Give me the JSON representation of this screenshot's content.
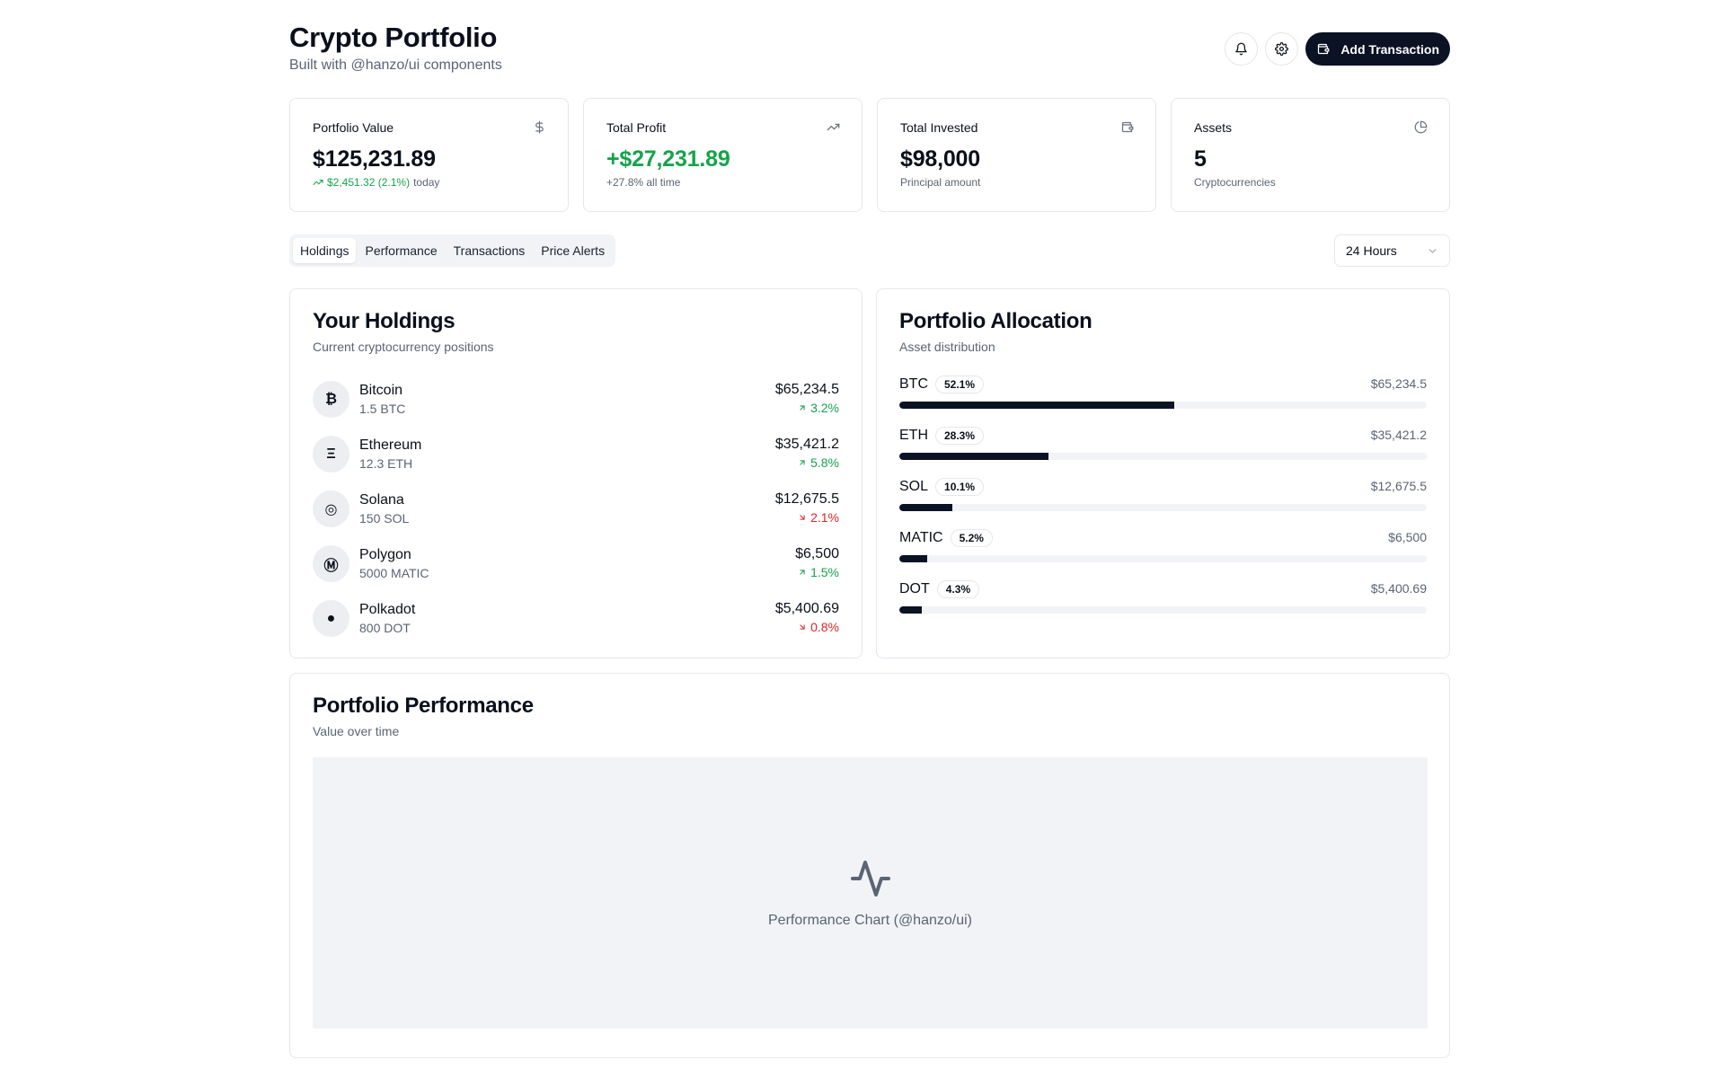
{
  "header": {
    "title": "Crypto Portfolio",
    "subtitle": "Built with @hanzo/ui components",
    "add_label": "Add Transaction"
  },
  "stats": [
    {
      "label": "Portfolio Value",
      "value": "$125,231.89",
      "sub_highlight": "$2,451.32 (2.1%)",
      "sub": "today",
      "icon": "dollar-icon"
    },
    {
      "label": "Total Profit",
      "value": "+$27,231.89",
      "sub": "+27.8% all time",
      "icon": "trending-up-icon"
    },
    {
      "label": "Total Invested",
      "value": "$98,000",
      "sub": "Principal amount",
      "icon": "wallet-icon"
    },
    {
      "label": "Assets",
      "value": "5",
      "sub": "Cryptocurrencies",
      "icon": "pie-chart-icon"
    }
  ],
  "tabs": [
    "Holdings",
    "Performance",
    "Transactions",
    "Price Alerts"
  ],
  "active_tab": "Holdings",
  "timeframe": "24 Hours",
  "holdings": {
    "title": "Your Holdings",
    "description": "Current cryptocurrency positions",
    "items": [
      {
        "symbol_glyph": "₿",
        "name": "Bitcoin",
        "amount": "1.5 BTC",
        "value": "$65,234.5",
        "change": "3.2%",
        "direction": "up"
      },
      {
        "symbol_glyph": "Ξ",
        "name": "Ethereum",
        "amount": "12.3 ETH",
        "value": "$35,421.2",
        "change": "5.8%",
        "direction": "up"
      },
      {
        "symbol_glyph": "◎",
        "name": "Solana",
        "amount": "150 SOL",
        "value": "$12,675.5",
        "change": "2.1%",
        "direction": "down"
      },
      {
        "symbol_glyph": "Ⓜ",
        "name": "Polygon",
        "amount": "5000 MATIC",
        "value": "$6,500",
        "change": "1.5%",
        "direction": "up"
      },
      {
        "symbol_glyph": "●",
        "name": "Polkadot",
        "amount": "800 DOT",
        "value": "$5,400.69",
        "change": "0.8%",
        "direction": "down"
      }
    ]
  },
  "allocation": {
    "title": "Portfolio Allocation",
    "description": "Asset distribution",
    "items": [
      {
        "symbol": "BTC",
        "percent_label": "52.1%",
        "percent": 52.1,
        "value": "$65,234.5"
      },
      {
        "symbol": "ETH",
        "percent_label": "28.3%",
        "percent": 28.3,
        "value": "$35,421.2"
      },
      {
        "symbol": "SOL",
        "percent_label": "10.1%",
        "percent": 10.1,
        "value": "$12,675.5"
      },
      {
        "symbol": "MATIC",
        "percent_label": "5.2%",
        "percent": 5.2,
        "value": "$6,500"
      },
      {
        "symbol": "DOT",
        "percent_label": "4.3%",
        "percent": 4.3,
        "value": "$5,400.69"
      }
    ]
  },
  "performance": {
    "title": "Portfolio Performance",
    "description": "Value over time",
    "placeholder": "Performance Chart (@hanzo/ui)"
  },
  "colors": {
    "accent": "#0b1224",
    "positive": "#16a34a",
    "negative": "#dc2626"
  }
}
